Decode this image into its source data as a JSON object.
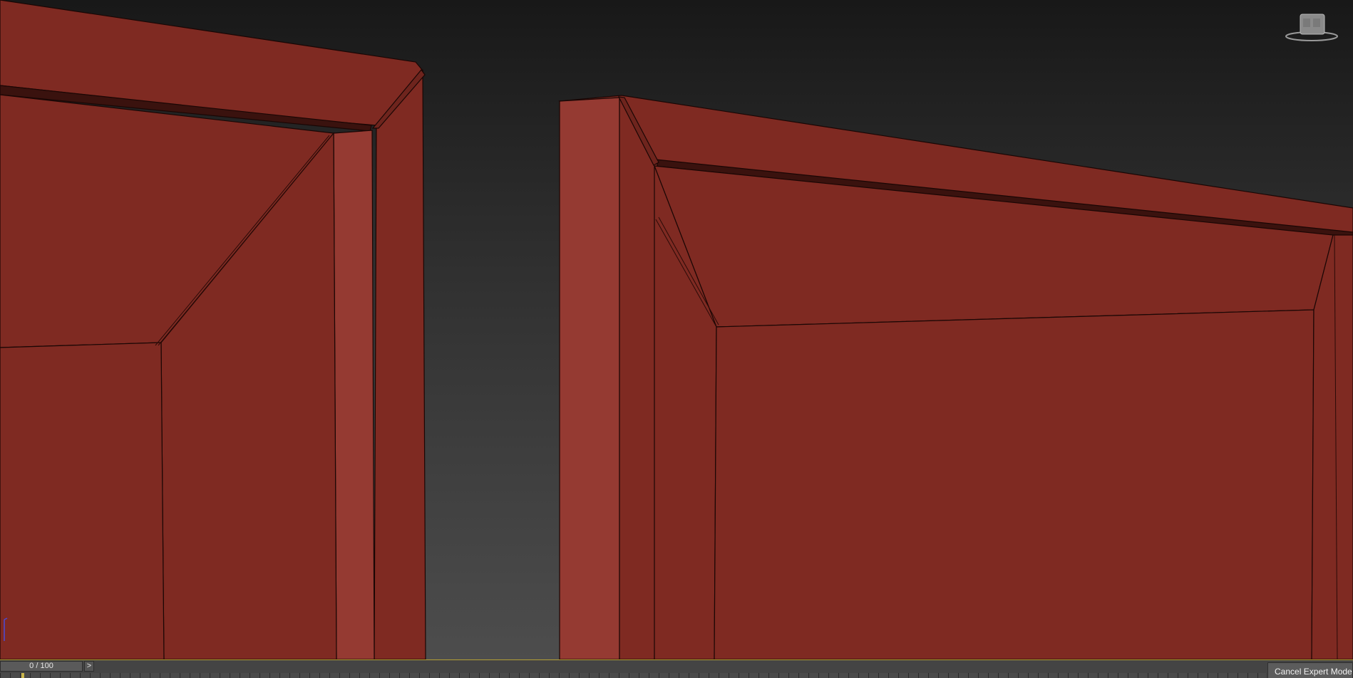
{
  "viewport": {
    "name": "Perspective viewport",
    "object_color": "#7f2a22",
    "object_highlight_color": "#953a32",
    "groove_color": "#3a120e",
    "background_top": "#181818",
    "background_bottom": "#4d4d4d",
    "viewcube_icon": "viewcube-icon",
    "axis_icon": "axis-tripod-icon"
  },
  "timeline": {
    "frame_display": "0 / 100",
    "current_frame": 0,
    "total_frames": 100,
    "next_button_label": ">"
  },
  "expert_mode": {
    "cancel_label": "Cancel Expert Mode"
  }
}
